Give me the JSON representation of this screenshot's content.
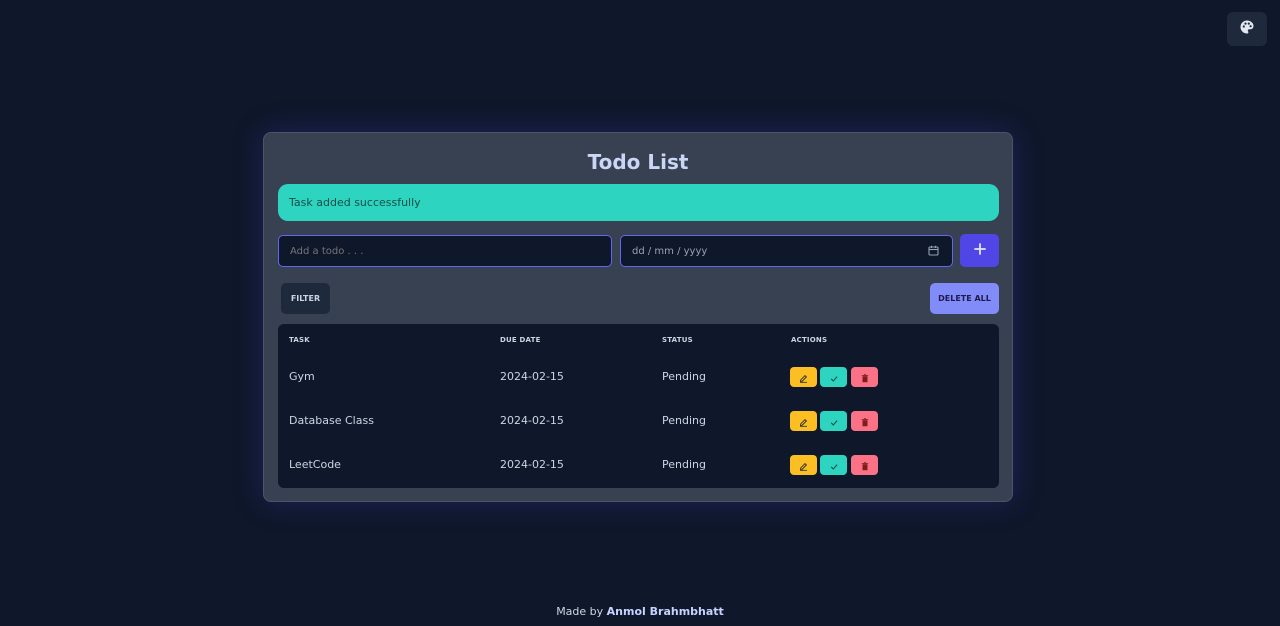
{
  "theme_toggle": {
    "icon": "palette-icon"
  },
  "card": {
    "title": "Todo List",
    "alert": "Task added successfully",
    "todo_input": {
      "placeholder": "Add a todo . . .",
      "value": ""
    },
    "date_input": {
      "placeholder": "dd / mm / yyyy",
      "icon": "calendar-icon"
    },
    "add_button": {
      "icon": "plus-icon"
    },
    "filter_label": "FILTER",
    "delete_all_label": "DELETE ALL"
  },
  "table": {
    "headers": {
      "task": "TASK",
      "due_date": "DUE DATE",
      "status": "STATUS",
      "actions": "ACTIONS"
    },
    "rows": [
      {
        "task": "Gym",
        "due_date": "2024-02-15",
        "status": "Pending"
      },
      {
        "task": "Database Class",
        "due_date": "2024-02-15",
        "status": "Pending"
      },
      {
        "task": "LeetCode",
        "due_date": "2024-02-15",
        "status": "Pending"
      }
    ],
    "action_icons": {
      "edit": "pencil-icon",
      "complete": "check-icon",
      "delete": "trash-icon"
    }
  },
  "footer": {
    "prefix": "Made by",
    "author": "Anmol Brahmbhatt"
  },
  "colors": {
    "background": "#0f172a",
    "card": "#374151",
    "accent": "#4f46e5",
    "success": "#2dd4bf",
    "warning": "#fbbf24",
    "danger": "#fb7185",
    "delete_all": "#818cf8"
  }
}
